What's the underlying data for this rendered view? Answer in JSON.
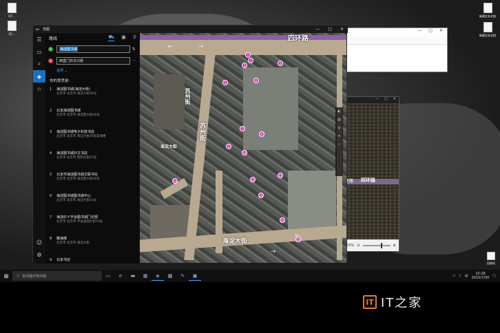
{
  "desktop": {
    "icons_left": [
      {
        "label": "Q7..."
      },
      {
        "label": "Q?..."
      }
    ],
    "icons_right": [
      {
        "label": "新建文本文档"
      },
      {
        "label": "新建文本文档"
      }
    ],
    "recycle": {
      "label": "回收站"
    }
  },
  "app": {
    "title": "地图",
    "back": "←",
    "controls": {
      "minimize": "—",
      "maximize": "□",
      "close": "✕"
    },
    "panel": {
      "heading": "路线",
      "modes": [
        "car-icon",
        "bus-icon",
        "walk-icon"
      ],
      "from": {
        "marker": "A",
        "value_highlight": "海淀图书城",
        "value_rest": ""
      },
      "to": {
        "marker": "B",
        "value": "西直门外文兴街"
      },
      "options_label": "选项 ⌄",
      "section_title": "你的意思是:",
      "results": [
        {
          "num": "1",
          "name": "海淀图书城(海淀大街)",
          "addr": "北京市 北京市 海淀大街36号"
        },
        {
          "num": "2",
          "name": "北京海淀图书城",
          "addr": "北京市 北京市 海淀西大街36号"
        },
        {
          "num": "3",
          "name": "海淀图书城电子科技书店",
          "addr": "北京市 北京市 海淀大街36号昊海楼"
        },
        {
          "num": "4",
          "name": "海淀图书城外文书店",
          "addr": "北京市 北京市 西苑大街25号"
        },
        {
          "num": "5",
          "name": "北京市海淀图书城文联书社",
          "addr": "北京市 北京市 海淀西大街36号"
        },
        {
          "num": "6",
          "name": "海淀图书城图书城中心",
          "addr": "北京市 北京市 海淀大街31号"
        },
        {
          "num": "7",
          "name": "海淀红十字会图书城门诊部",
          "addr": "北京市 北京市 平安里西大街70号"
        },
        {
          "num": "8",
          "name": "籍海楼",
          "addr": "北京市 北京市 海淀大街"
        },
        {
          "num": "9",
          "name": "北京书店",
          "addr": ""
        }
      ]
    },
    "map": {
      "road_top": "四环路",
      "road_left": "苏州街",
      "road_left2": "苏州街",
      "road_bottom": "海淀大街",
      "road_side": "海淀大街",
      "pins": [
        "1",
        "2",
        "3",
        "4",
        "5",
        "6",
        "7",
        "8",
        "9",
        "10",
        "11",
        "12",
        "13",
        "14",
        "15",
        "16",
        "17",
        "18",
        "19"
      ],
      "controls": [
        "compass-icon",
        "layers-icon",
        "location-icon",
        "zoom-in-icon",
        "zoom-out-icon"
      ]
    }
  },
  "window2": {
    "controls": {
      "minimize": "—",
      "maximize": "□",
      "close": "✕"
    },
    "road_label": "四环路",
    "road_label2": "环路",
    "zoom": "100%"
  },
  "window_white": {
    "controls": {
      "minimize": "—",
      "maximize": "□",
      "close": "✕"
    }
  },
  "taskbar": {
    "search_placeholder": "有问题尽管问我",
    "time": "10:28",
    "date": "2015/7/30"
  },
  "watermark": {
    "text_a": "IT之家",
    "logo": "IT"
  }
}
